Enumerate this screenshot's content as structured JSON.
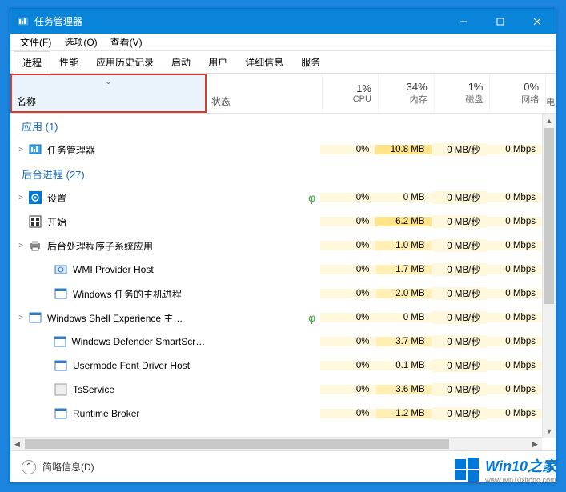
{
  "window": {
    "title": "任务管理器"
  },
  "menu": {
    "file": "文件(F)",
    "options": "选项(O)",
    "view": "查看(V)"
  },
  "tabs": [
    "进程",
    "性能",
    "应用历史记录",
    "启动",
    "用户",
    "详细信息",
    "服务"
  ],
  "columns": {
    "name": "名称",
    "status": "状态",
    "cpu": {
      "pct": "1%",
      "label": "CPU"
    },
    "mem": {
      "pct": "34%",
      "label": "内存"
    },
    "disk": {
      "pct": "1%",
      "label": "磁盘"
    },
    "net": {
      "pct": "0%",
      "label": "网络"
    },
    "extra": "电"
  },
  "groups": {
    "apps": "应用 (1)",
    "bg": "后台进程 (27)"
  },
  "rows": [
    {
      "expand": true,
      "icon": "taskmgr",
      "name": "任务管理器",
      "cpu": "0%",
      "mem": "10.8 MB",
      "disk": "0 MB/秒",
      "net": "0 Mbps",
      "indent": false,
      "leaf": false
    },
    {
      "expand": true,
      "icon": "gear",
      "name": "设置",
      "cpu": "0%",
      "mem": "0 MB",
      "disk": "0 MB/秒",
      "net": "0 Mbps",
      "indent": false,
      "leaf": true
    },
    {
      "expand": false,
      "icon": "start",
      "name": "开始",
      "cpu": "0%",
      "mem": "6.2 MB",
      "disk": "0 MB/秒",
      "net": "0 Mbps",
      "indent": false,
      "leaf": false
    },
    {
      "expand": true,
      "icon": "printer",
      "name": "后台处理程序子系统应用",
      "cpu": "0%",
      "mem": "1.0 MB",
      "disk": "0 MB/秒",
      "net": "0 Mbps",
      "indent": false,
      "leaf": false
    },
    {
      "expand": false,
      "icon": "service",
      "name": "WMI Provider Host",
      "cpu": "0%",
      "mem": "1.7 MB",
      "disk": "0 MB/秒",
      "net": "0 Mbps",
      "indent": true,
      "leaf": false
    },
    {
      "expand": false,
      "icon": "window",
      "name": "Windows 任务的主机进程",
      "cpu": "0%",
      "mem": "2.0 MB",
      "disk": "0 MB/秒",
      "net": "0 Mbps",
      "indent": true,
      "leaf": false
    },
    {
      "expand": true,
      "icon": "window",
      "name": "Windows Shell Experience 主…",
      "cpu": "0%",
      "mem": "0 MB",
      "disk": "0 MB/秒",
      "net": "0 Mbps",
      "indent": false,
      "leaf": true
    },
    {
      "expand": false,
      "icon": "window",
      "name": "Windows Defender SmartScr…",
      "cpu": "0%",
      "mem": "3.7 MB",
      "disk": "0 MB/秒",
      "net": "0 Mbps",
      "indent": true,
      "leaf": false
    },
    {
      "expand": false,
      "icon": "window",
      "name": "Usermode Font Driver Host",
      "cpu": "0%",
      "mem": "0.1 MB",
      "disk": "0 MB/秒",
      "net": "0 Mbps",
      "indent": true,
      "leaf": false
    },
    {
      "expand": false,
      "icon": "generic",
      "name": "TsService",
      "cpu": "0%",
      "mem": "3.6 MB",
      "disk": "0 MB/秒",
      "net": "0 Mbps",
      "indent": true,
      "leaf": false
    },
    {
      "expand": false,
      "icon": "window",
      "name": "Runtime Broker",
      "cpu": "0%",
      "mem": "1.2 MB",
      "disk": "0 MB/秒",
      "net": "0 Mbps",
      "indent": true,
      "leaf": false
    }
  ],
  "footer": {
    "label": "简略信息(D)"
  },
  "watermark": {
    "brand": "Win10之家",
    "url": "www.win10xitong.com"
  }
}
